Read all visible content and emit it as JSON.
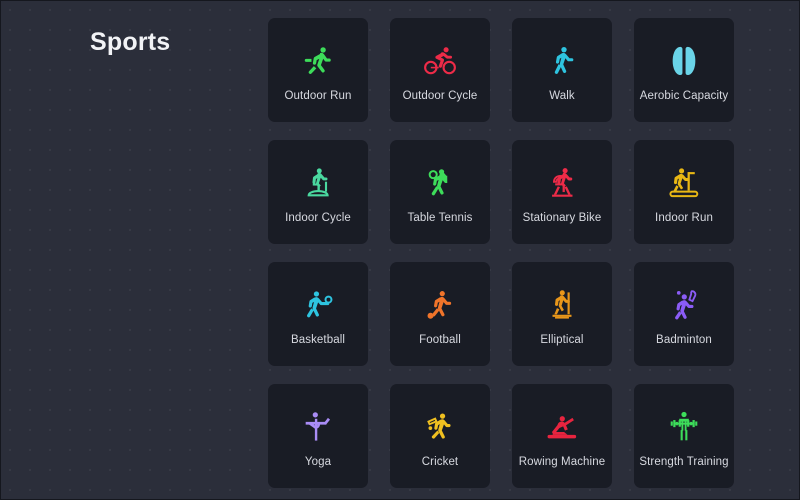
{
  "page": {
    "title": "Sports",
    "background_color": "#2b2e3a",
    "card_color": "#191c25",
    "label_color": "#d7d9e0"
  },
  "grid": {
    "columns": 4,
    "rows": 4,
    "cards": [
      {
        "label": "Outdoor Run",
        "icon": "running-person-icon",
        "color": "#3ddc5a"
      },
      {
        "label": "Outdoor Cycle",
        "icon": "cyclist-icon",
        "color": "#ed2b48"
      },
      {
        "label": "Walk",
        "icon": "walking-person-icon",
        "color": "#2ec4e0"
      },
      {
        "label": "Aerobic Capacity",
        "icon": "lungs-icon",
        "color": "#6ad4e8"
      },
      {
        "label": "Indoor Cycle",
        "icon": "indoor-cycle-icon",
        "color": "#4ad9a0"
      },
      {
        "label": "Table Tennis",
        "icon": "table-tennis-player-icon",
        "color": "#3ddc5a"
      },
      {
        "label": "Stationary Bike",
        "icon": "stationary-bike-icon",
        "color": "#ed2b48"
      },
      {
        "label": "Indoor Run",
        "icon": "treadmill-icon",
        "color": "#e8b714"
      },
      {
        "label": "Basketball",
        "icon": "basketball-player-icon",
        "color": "#2ec4e0"
      },
      {
        "label": "Football",
        "icon": "football-player-icon",
        "color": "#f0742a"
      },
      {
        "label": "Elliptical",
        "icon": "elliptical-machine-icon",
        "color": "#e8961a"
      },
      {
        "label": "Badminton",
        "icon": "badminton-player-icon",
        "color": "#8b5cf6"
      },
      {
        "label": "Yoga",
        "icon": "yoga-pose-icon",
        "color": "#a98cf5"
      },
      {
        "label": "Cricket",
        "icon": "cricket-player-icon",
        "color": "#f0c020"
      },
      {
        "label": "Rowing Machine",
        "icon": "rowing-machine-icon",
        "color": "#e8243f"
      },
      {
        "label": "Strength Training",
        "icon": "barbell-lifter-icon",
        "color": "#3ddc5a"
      }
    ]
  }
}
